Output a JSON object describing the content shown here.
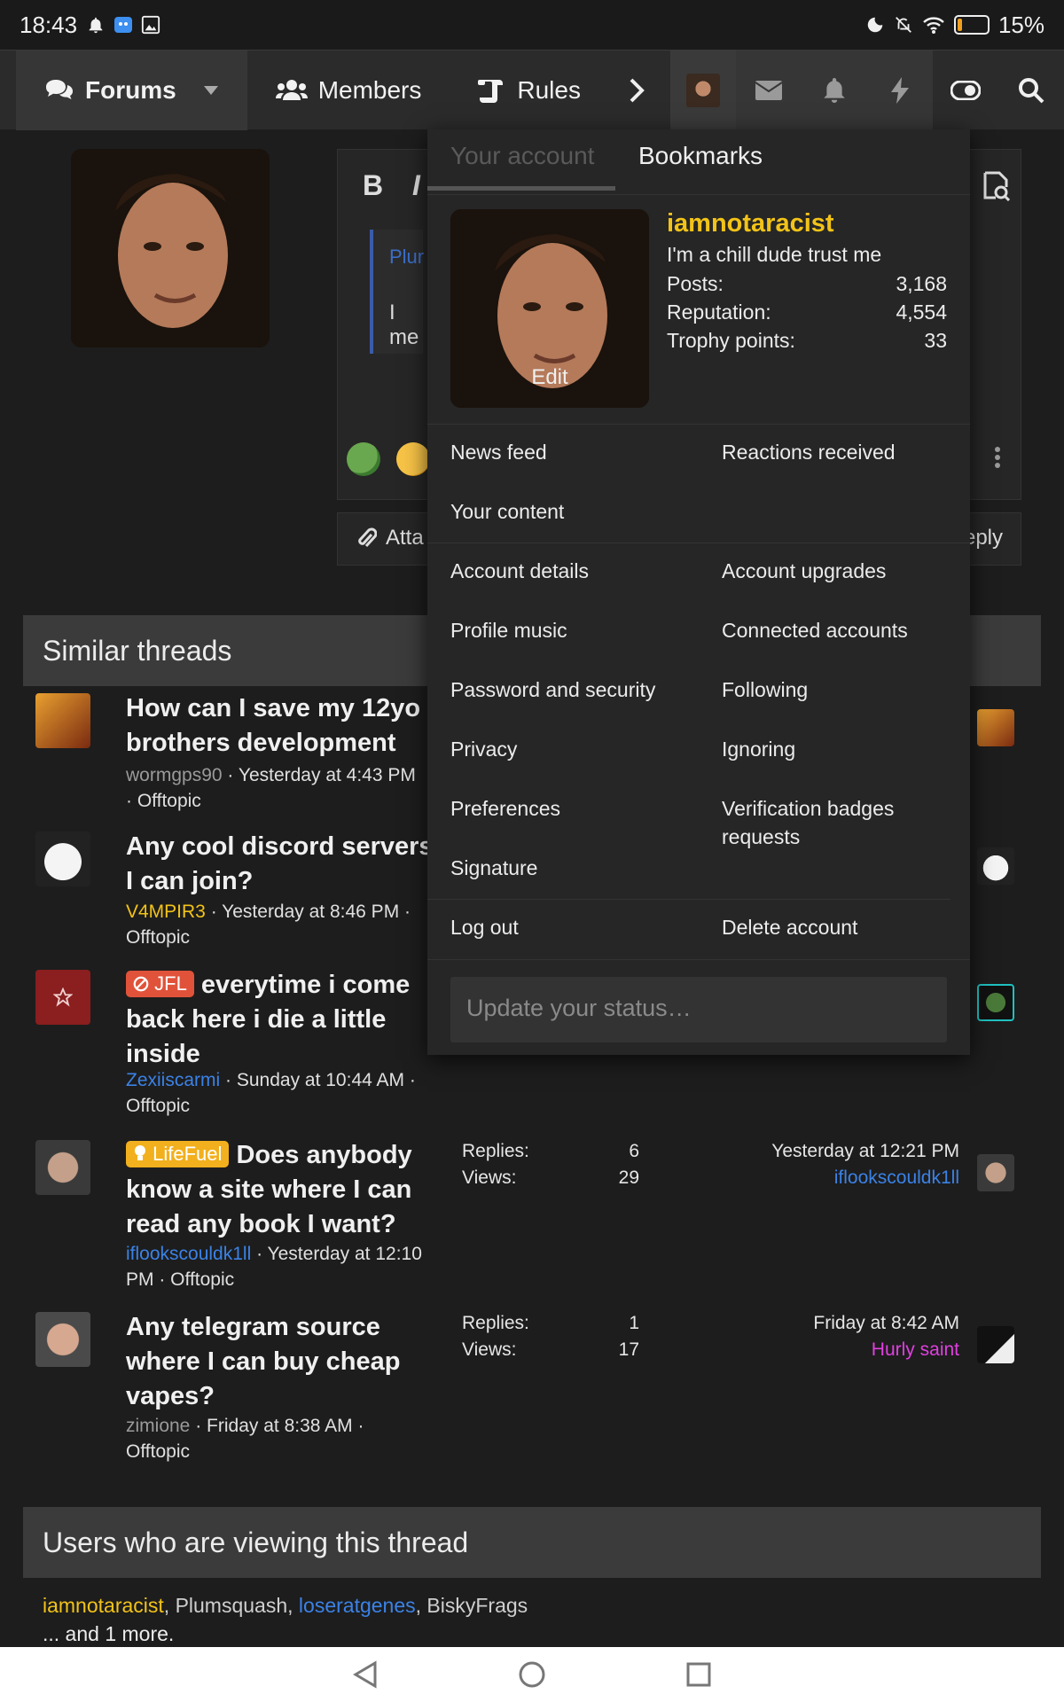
{
  "status_bar": {
    "time": "18:43",
    "battery": "15%",
    "battery_level": 0.15
  },
  "nav": {
    "tabs": [
      {
        "label": "Forums"
      },
      {
        "label": "Members"
      },
      {
        "label": "Rules"
      }
    ],
    "tools": [
      "chevron-right-icon",
      "avatar",
      "envelope-icon",
      "bell-icon",
      "bolt-icon",
      "toggle-icon",
      "search-icon"
    ]
  },
  "editor": {
    "bold": "B",
    "italic": "I",
    "quote_author": "Plur",
    "quote_text": "I me",
    "attach": "Atta",
    "reply": "eply"
  },
  "similar": {
    "heading": "Similar threads",
    "threads": [
      {
        "title": "How can I save my 12yo brothers development",
        "author": "wormgps90",
        "date": "Yesterday at 4:43 PM",
        "forum": "Offtopic"
      },
      {
        "title": "Any cool discord servers I can join?",
        "author": "V4MPIR3",
        "date": "Yesterday at 8:46 PM",
        "forum": "Offtopic"
      },
      {
        "prefix": "JFL",
        "title": "everytime i come back here i die a little inside",
        "author": "Zexiiscarmi",
        "date": "Sunday at 10:44 AM",
        "forum": "Offtopic"
      },
      {
        "prefix": "LifeFuel",
        "title": "Does anybody know a site where I can read any book I want?",
        "author": "iflookscouldk1ll",
        "date": "Yesterday at 12:10 PM",
        "forum": "Offtopic",
        "replies_label": "Replies:",
        "replies": "6",
        "views_label": "Views:",
        "views": "29",
        "last_date": "Yesterday at 12:21 PM",
        "last_user": "iflookscouldk1ll"
      },
      {
        "title": "Any telegram source where I can buy cheap vapes?",
        "author": "zimione",
        "date": "Friday at 8:38 AM",
        "forum": "Offtopic",
        "replies_label": "Replies:",
        "replies": "1",
        "views_label": "Views:",
        "views": "17",
        "last_date": "Friday at 8:42 AM",
        "last_user": "Hurly saint"
      }
    ]
  },
  "viewers": {
    "heading": "Users who are viewing this thread",
    "users": [
      "iamnotaracist",
      "Plumsquash",
      "loseratgenes",
      "BiskyFrags"
    ],
    "more": "... and 1 more."
  },
  "account_menu": {
    "tabs": [
      "Your account",
      "Bookmarks"
    ],
    "edit": "Edit",
    "username": "iamnotaracist",
    "user_title": "I'm a chill dude trust me",
    "stats": [
      {
        "label": "Posts:",
        "value": "3,168"
      },
      {
        "label": "Reputation:",
        "value": "4,554"
      },
      {
        "label": "Trophy points:",
        "value": "33"
      }
    ],
    "links": {
      "news_feed": "News feed",
      "reactions": "Reactions received",
      "content": "Your content",
      "account_details": "Account details",
      "upgrades": "Account upgrades",
      "profile_music": "Profile music",
      "connected": "Connected accounts",
      "password": "Password and security",
      "following": "Following",
      "privacy": "Privacy",
      "ignoring": "Ignoring",
      "preferences": "Preferences",
      "verification": "Verification badges requests",
      "signature": "Signature",
      "logout": "Log out",
      "delete": "Delete account"
    },
    "status_placeholder": "Update your status…"
  },
  "colors": {
    "accent_gold": "#f2c318",
    "link_blue": "#3b82e6",
    "magenta": "#e040e0"
  }
}
